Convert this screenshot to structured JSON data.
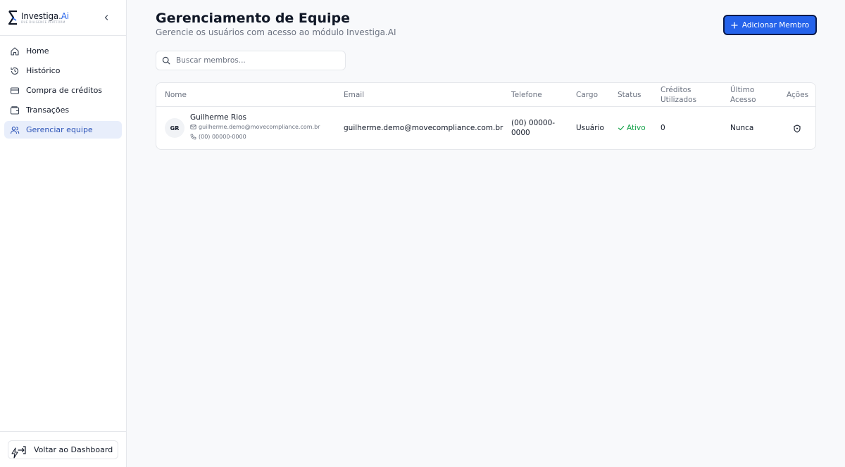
{
  "sidebar": {
    "logo": {
      "name": "Investiga.",
      "ai": "Ai",
      "tagline": "DUE DILIGENCE PLATFORM"
    },
    "items": [
      {
        "label": "Home",
        "icon": "home-icon"
      },
      {
        "label": "Histórico",
        "icon": "history-icon"
      },
      {
        "label": "Compra de créditos",
        "icon": "credit-card-icon"
      },
      {
        "label": "Transações",
        "icon": "wallet-icon"
      },
      {
        "label": "Gerenciar equipe",
        "icon": "users-icon",
        "active": true
      }
    ],
    "back_label": "Voltar ao Dashboard"
  },
  "header": {
    "title": "Gerenciamento de Equipe",
    "subtitle": "Gerencie os usuários com acesso ao módulo Investiga.AI",
    "add_label": "Adicionar Membro"
  },
  "search": {
    "placeholder": "Buscar membros..."
  },
  "table": {
    "headers": {
      "name": "Nome",
      "email": "Email",
      "phone": "Telefone",
      "role": "Cargo",
      "status": "Status",
      "credits_1": "Créditos",
      "credits_2": "Utilizados",
      "last_1": "Último",
      "last_2": "Acesso",
      "actions": "Ações"
    },
    "rows": [
      {
        "initials": "GR",
        "name": "Guilherme Rios",
        "email": "guilherme.demo@movecompliance.com.br",
        "phone": "(00) 00000-0000",
        "phone_line1": "(00) 00000-",
        "phone_line2": "0000",
        "role": "Usuário",
        "status": "Ativo",
        "credits": "0",
        "last_access": "Nunca"
      }
    ]
  },
  "colors": {
    "primary": "#2563eb",
    "active_bg": "#e8eefb",
    "active_text": "#2e55b8",
    "success": "#16a34a"
  }
}
